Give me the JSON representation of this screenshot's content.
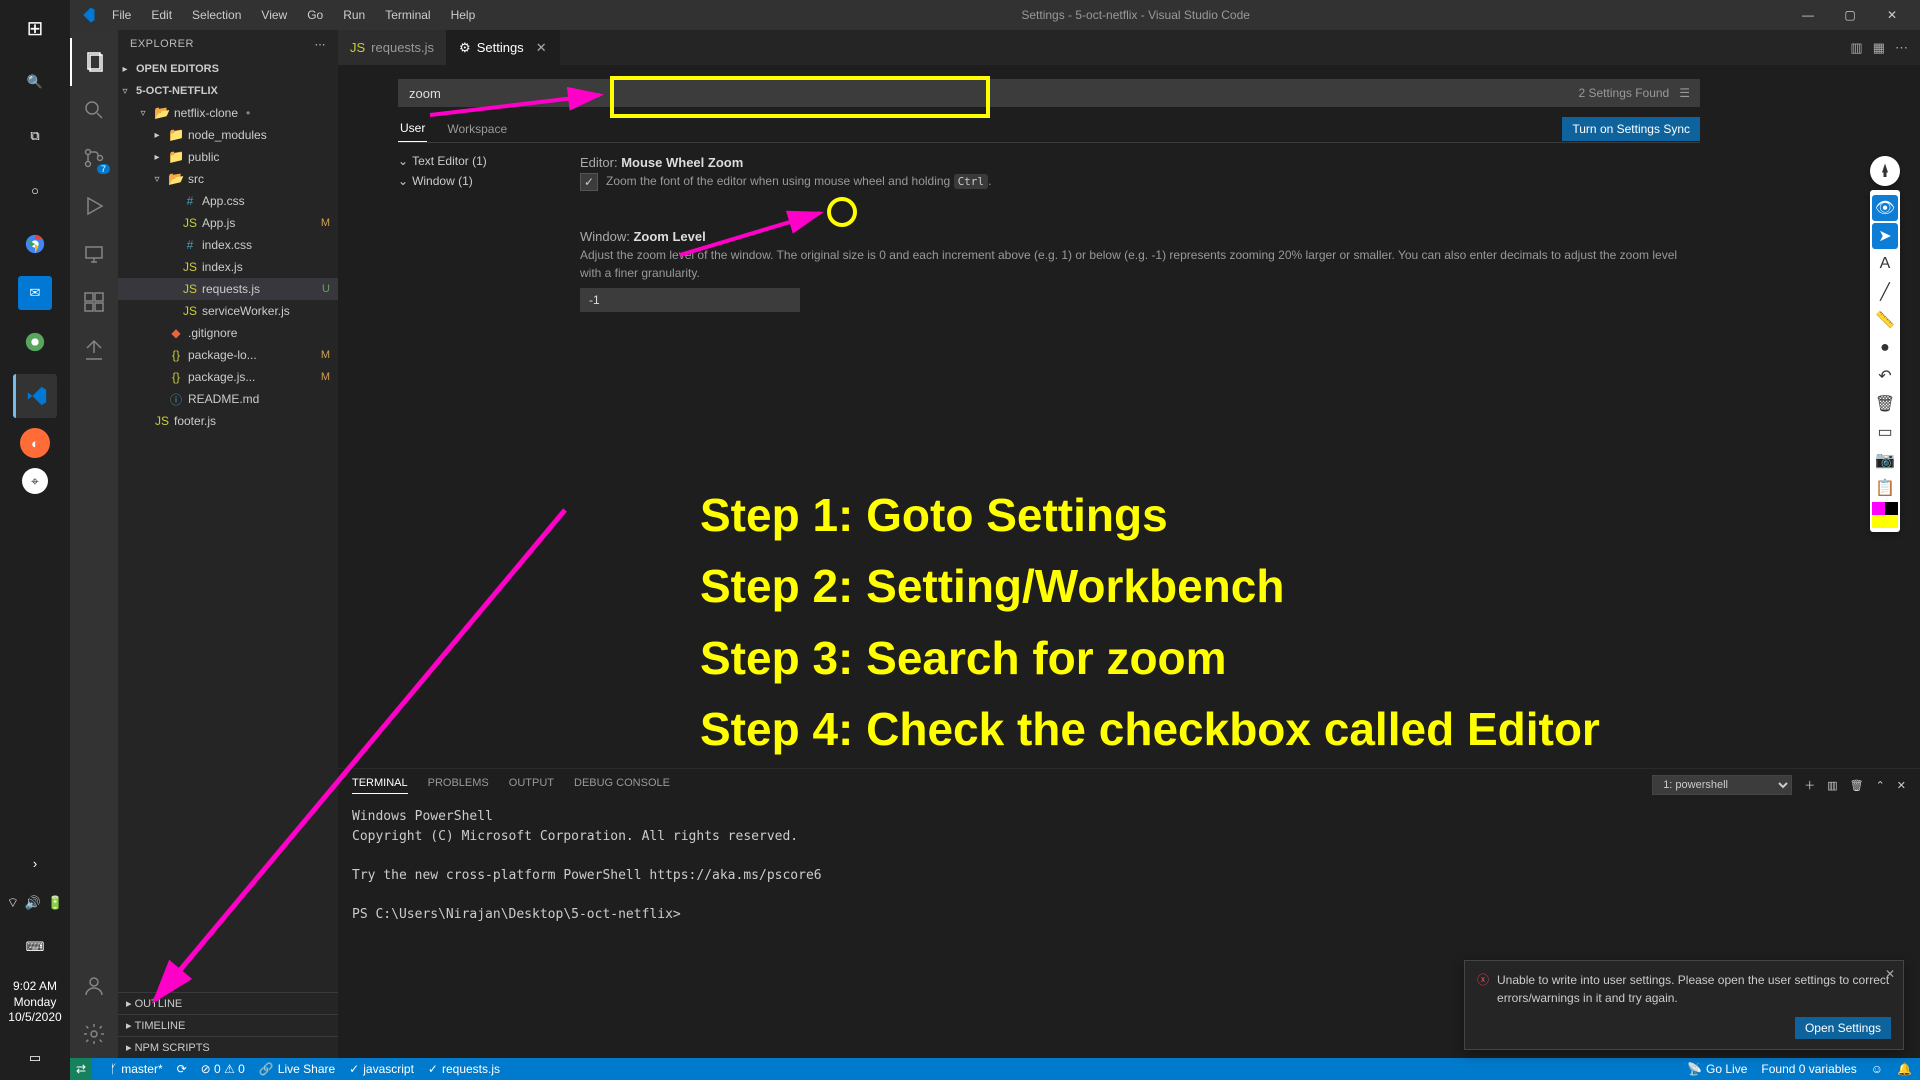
{
  "win_taskbar": {
    "time": "9:02 AM",
    "day": "Monday",
    "date": "10/5/2020"
  },
  "titlebar": {
    "menu": [
      "File",
      "Edit",
      "Selection",
      "View",
      "Go",
      "Run",
      "Terminal",
      "Help"
    ],
    "title": "Settings - 5-oct-netflix - Visual Studio Code"
  },
  "sidebar": {
    "header": "EXPLORER",
    "open_editors": "OPEN EDITORS",
    "root": "5-OCT-NETFLIX",
    "tree": [
      {
        "d": 1,
        "c": "▿",
        "i": "fold2",
        "n": "netflix-clone",
        "dot": true
      },
      {
        "d": 2,
        "c": "▸",
        "i": "fold",
        "n": "node_modules"
      },
      {
        "d": 2,
        "c": "▸",
        "i": "fold",
        "n": "public"
      },
      {
        "d": 2,
        "c": "▿",
        "i": "fold2",
        "n": "src"
      },
      {
        "d": 3,
        "c": "",
        "i": "css",
        "n": "App.css"
      },
      {
        "d": 3,
        "c": "",
        "i": "js",
        "n": "App.js",
        "m": "M"
      },
      {
        "d": 3,
        "c": "",
        "i": "css",
        "n": "index.css"
      },
      {
        "d": 3,
        "c": "",
        "i": "js",
        "n": "index.js"
      },
      {
        "d": 3,
        "c": "",
        "i": "js",
        "n": "requests.js",
        "u": "U",
        "sel": true
      },
      {
        "d": 3,
        "c": "",
        "i": "js",
        "n": "serviceWorker.js"
      },
      {
        "d": 2,
        "c": "",
        "i": "git",
        "n": ".gitignore"
      },
      {
        "d": 2,
        "c": "",
        "i": "json",
        "n": "package-lo...",
        "m": "M"
      },
      {
        "d": 2,
        "c": "",
        "i": "json",
        "n": "package.js...",
        "m": "M"
      },
      {
        "d": 2,
        "c": "",
        "i": "md",
        "n": "README.md"
      },
      {
        "d": 1,
        "c": "",
        "i": "js",
        "n": "footer.js"
      }
    ],
    "sections": [
      "OUTLINE",
      "TIMELINE",
      "NPM SCRIPTS"
    ]
  },
  "tabs": {
    "items": [
      {
        "icon": "js",
        "label": "requests.js",
        "active": false
      },
      {
        "icon": "gear",
        "label": "Settings",
        "active": true
      }
    ]
  },
  "settings": {
    "search_value": "zoom",
    "found": "2 Settings Found",
    "scopes": {
      "user": "User",
      "workspace": "Workspace"
    },
    "sync_btn": "Turn on Settings Sync",
    "tree": [
      {
        "label": "Text Editor (1)"
      },
      {
        "label": "Window (1)"
      }
    ],
    "item1": {
      "cat": "Editor:",
      "name": "Mouse Wheel Zoom",
      "desc": "Zoom the font of the editor when using mouse wheel and holding ",
      "code": "Ctrl",
      "desc2": "."
    },
    "item2": {
      "cat": "Window:",
      "name": "Zoom Level",
      "desc": "Adjust the zoom level of the window. The original size is 0 and each increment above (e.g. 1) or below (e.g. -1) represents zooming 20% larger or smaller. You can also enter decimals to adjust the zoom level with a finer granularity.",
      "value": "-1"
    }
  },
  "panel": {
    "tabs": [
      "TERMINAL",
      "PROBLEMS",
      "OUTPUT",
      "DEBUG CONSOLE"
    ],
    "shell": "1: powershell",
    "lines": "Windows PowerShell\nCopyright (C) Microsoft Corporation. All rights reserved.\n\nTry the new cross-platform PowerShell https://aka.ms/pscore6\n\nPS C:\\Users\\Nirajan\\Desktop\\5-oct-netflix>"
  },
  "statusbar": {
    "branch": "master*",
    "sync": "⟳",
    "errors": "⊘ 0 ⚠ 0",
    "live": "Live Share",
    "lang": "javascript",
    "file": "requests.js",
    "golive": "Go Live",
    "vars": "Found 0 variables"
  },
  "toast": {
    "msg": "Unable to write into user settings. Please open the user settings to correct errors/warnings in it and try again.",
    "btn": "Open Settings"
  },
  "annotations": {
    "steps": [
      "Step 1: Goto Settings",
      "Step 2: Setting/Workbench",
      "Step 3: Search for zoom",
      "Step 4: Check the checkbox called Editor"
    ]
  }
}
